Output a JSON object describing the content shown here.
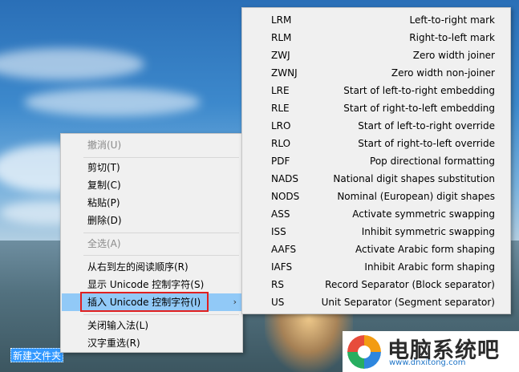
{
  "context_menu": {
    "items": [
      {
        "label": "撤消(U)",
        "disabled": true
      },
      {
        "label": "剪切(T)",
        "disabled": false
      },
      {
        "label": "复制(C)",
        "disabled": false
      },
      {
        "label": "粘贴(P)",
        "disabled": false
      },
      {
        "label": "删除(D)",
        "disabled": false
      },
      {
        "label": "全选(A)",
        "disabled": true
      },
      {
        "label": "从右到左的阅读顺序(R)",
        "disabled": false
      },
      {
        "label": "显示 Unicode 控制字符(S)",
        "disabled": false
      },
      {
        "label": "插入 Unicode 控制字符(I)",
        "disabled": false,
        "highlighted": true,
        "has_submenu": true
      },
      {
        "label": "关闭输入法(L)",
        "disabled": false
      },
      {
        "label": "汉字重选(R)",
        "disabled": false
      }
    ],
    "submenu_arrow": "›"
  },
  "submenu": {
    "items": [
      {
        "code": "LRM",
        "desc": "Left-to-right mark"
      },
      {
        "code": "RLM",
        "desc": "Right-to-left mark"
      },
      {
        "code": "ZWJ",
        "desc": "Zero width joiner"
      },
      {
        "code": "ZWNJ",
        "desc": "Zero width non-joiner"
      },
      {
        "code": "LRE",
        "desc": "Start of left-to-right embedding"
      },
      {
        "code": "RLE",
        "desc": "Start of right-to-left embedding"
      },
      {
        "code": "LRO",
        "desc": "Start of left-to-right override"
      },
      {
        "code": "RLO",
        "desc": "Start of right-to-left override"
      },
      {
        "code": "PDF",
        "desc": "Pop directional formatting"
      },
      {
        "code": "NADS",
        "desc": "National digit shapes substitution"
      },
      {
        "code": "NODS",
        "desc": "Nominal (European) digit shapes"
      },
      {
        "code": "ASS",
        "desc": "Activate symmetric swapping"
      },
      {
        "code": "ISS",
        "desc": "Inhibit symmetric swapping"
      },
      {
        "code": "AAFS",
        "desc": "Activate Arabic form shaping"
      },
      {
        "code": "IAFS",
        "desc": "Inhibit Arabic form shaping"
      },
      {
        "code": "RS",
        "desc": "Record Separator (Block separator)"
      },
      {
        "code": "US",
        "desc": "Unit Separator (Segment separator)"
      }
    ]
  },
  "desktop": {
    "rename_field_value": "新建文件夹"
  },
  "watermark": {
    "name": "电脑系统吧",
    "url": "www.dnxitong.com"
  },
  "colors": {
    "highlight": "#91c9f7",
    "red_box": "#e02020",
    "menu_bg": "#f0f0f0"
  }
}
